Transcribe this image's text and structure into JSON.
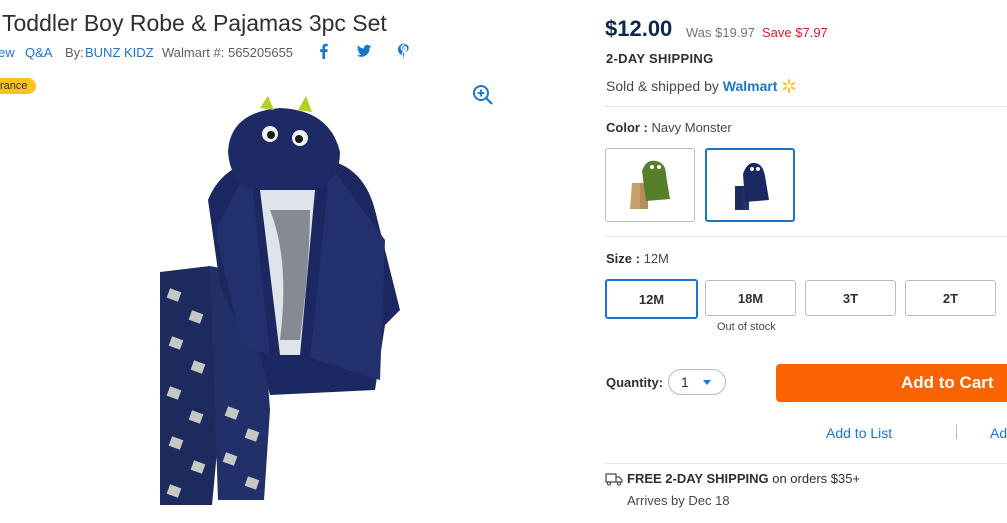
{
  "product": {
    "title": "Toddler Boy Robe & Pajamas 3pc Set",
    "review_fragment": "ew",
    "qa_label": "Q&A",
    "by_label": "By:",
    "brand": "BUNZ KIDZ",
    "walmart_number": "Walmart #: 565205655",
    "badge": "rance"
  },
  "pricing": {
    "price": "$12.00",
    "was": "Was $19.97",
    "save": "Save $7.97",
    "shipping_headline": "2-DAY SHIPPING",
    "sold_by_prefix": "Sold & shipped by",
    "seller": "Walmart"
  },
  "color": {
    "label": "Color :",
    "value": "Navy Monster"
  },
  "size": {
    "label": "Size :",
    "value": "12M",
    "options": [
      {
        "label": "12M",
        "note": ""
      },
      {
        "label": "18M",
        "note": "Out of stock"
      },
      {
        "label": "3T",
        "note": ""
      },
      {
        "label": "2T",
        "note": ""
      }
    ]
  },
  "quantity": {
    "label": "Quantity:",
    "value": "1"
  },
  "actions": {
    "add_to_cart": "Add to Cart",
    "add_to_list": "Add to List",
    "add_partial": "Ad"
  },
  "shipping": {
    "free_label": "FREE 2-DAY SHIPPING",
    "free_suffix": "on orders $35+",
    "arrives": "Arrives by Dec 18"
  },
  "icons": [
    "facebook-icon",
    "twitter-icon",
    "pinterest-icon",
    "zoom-in-icon",
    "walmart-spark-icon",
    "truck-icon",
    "caret-down-icon"
  ],
  "colors": {
    "accent": "#1a75cf",
    "cart": "#f96302",
    "price": "#0b2750",
    "save": "#de1c24",
    "badge": "#ffc220"
  }
}
